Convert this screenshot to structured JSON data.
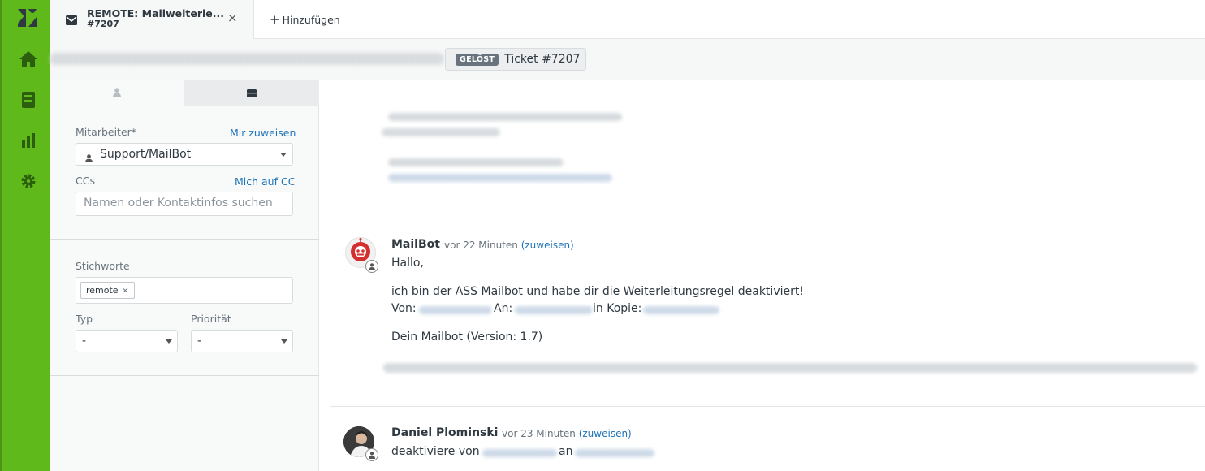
{
  "tab": {
    "title": "REMOTE: Mailweiterle...",
    "ticket_ref": "#7207",
    "close_glyph": "×",
    "add_label": "Hinzufügen"
  },
  "breadcrumb": {
    "status_badge": "GELÖST",
    "ticket_label": "Ticket #7207"
  },
  "sidebar": {
    "assignee": {
      "label": "Mitarbeiter*",
      "link": "Mir zuweisen",
      "value": "Support/MailBot"
    },
    "ccs": {
      "label": "CCs",
      "link": "Mich auf CC",
      "placeholder": "Namen oder Kontaktinfos suchen"
    },
    "tags": {
      "label": "Stichworte",
      "items": [
        "remote"
      ]
    },
    "type": {
      "label": "Typ",
      "value": "-"
    },
    "priority": {
      "label": "Priorität",
      "value": "-"
    }
  },
  "conversation": {
    "messages": [
      {
        "author": "MailBot",
        "time": "vor 22 Minuten",
        "assign_link": "(zuweisen)",
        "greeting": "Hallo,",
        "line1": "ich bin der ASS Mailbot und habe dir die Weiterleitungsregel deaktiviert!",
        "from_label": "Von:",
        "to_label": "An:",
        "cc_label": "in Kopie:",
        "signature": "Dein Mailbot (Version: 1.7)"
      },
      {
        "author": "Daniel Plominski",
        "time": "vor 23 Minuten",
        "assign_link": "(zuweisen)",
        "line_start": "deaktiviere von",
        "line_mid": "an"
      }
    ]
  },
  "colors": {
    "nav_green": "#5fb91b",
    "link_blue": "#1f73b7",
    "badge_gray": "#68737d",
    "bot_red": "#d32f2f"
  },
  "icons": {
    "logo": "zendesk-logo-icon",
    "nav": [
      "home-icon",
      "views-icon",
      "reporting-icon",
      "admin-gear-icon"
    ],
    "tab": "mail-icon",
    "sidebar_tabs": [
      "user-icon",
      "ticket-icon"
    ]
  }
}
